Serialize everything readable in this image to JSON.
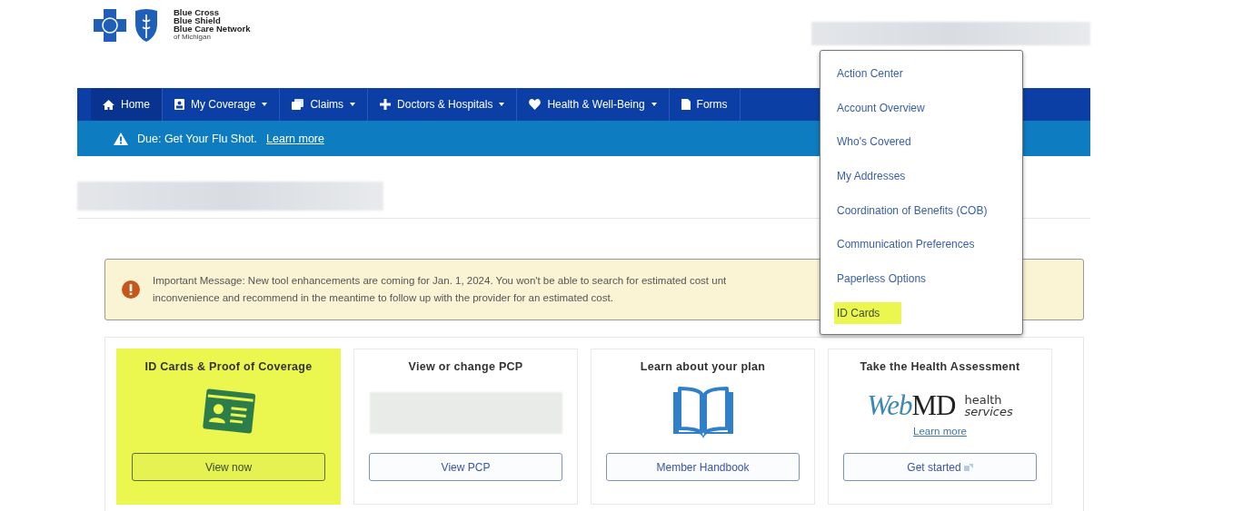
{
  "logo": {
    "lines": [
      "Blue Cross",
      "Blue Shield",
      "Blue Care Network"
    ],
    "sub": "of Michigan"
  },
  "nav": [
    {
      "label": "Home",
      "kind": "home",
      "selected": true,
      "dropdown": false
    },
    {
      "label": "My Coverage",
      "kind": "card",
      "selected": false,
      "dropdown": true
    },
    {
      "label": "Claims",
      "kind": "docs",
      "selected": false,
      "dropdown": true
    },
    {
      "label": "Doctors & Hospitals",
      "kind": "plus",
      "selected": false,
      "dropdown": true
    },
    {
      "label": "Health & Well-Being",
      "kind": "heart",
      "selected": false,
      "dropdown": true
    },
    {
      "label": "Forms",
      "kind": "file",
      "selected": false,
      "dropdown": false
    }
  ],
  "alert": {
    "text": "Due: Get Your Flu Shot.",
    "link": "Learn more"
  },
  "message": {
    "text": "Important Message: New tool enhancements are coming for Jan. 1, 2024. You won't be able to search for estimated cost unt",
    "text_2": "inconvenience and recommend in the meantime to follow up with the provider for an estimated cost."
  },
  "cards": [
    {
      "title": "ID Cards & Proof of Coverage",
      "kind": "idcard",
      "highlighted": true,
      "button": "View now"
    },
    {
      "title": "View or change PCP",
      "kind": "redacted",
      "highlighted": false,
      "button": "View PCP"
    },
    {
      "title": "Learn about your plan",
      "kind": "book",
      "highlighted": false,
      "button": "Member Handbook"
    },
    {
      "title": "Take the Health Assessment",
      "kind": "webmd",
      "highlighted": false,
      "button": "Get started",
      "logo": {
        "web": "Web",
        "md": "MD",
        "line_1": "health",
        "line_2": "services"
      },
      "link": "Learn more"
    }
  ],
  "menu": [
    {
      "label": "Action Center",
      "selected": false
    },
    {
      "label": "Account Overview",
      "selected": false
    },
    {
      "label": "Who's Covered",
      "selected": false
    },
    {
      "label": "My Addresses",
      "selected": false
    },
    {
      "label": "Coordination of Benefits (COB)",
      "selected": false
    },
    {
      "label": "Communication Preferences",
      "selected": false
    },
    {
      "label": "Paperless Options",
      "selected": false
    },
    {
      "label": "ID Cards",
      "selected": true
    }
  ]
}
